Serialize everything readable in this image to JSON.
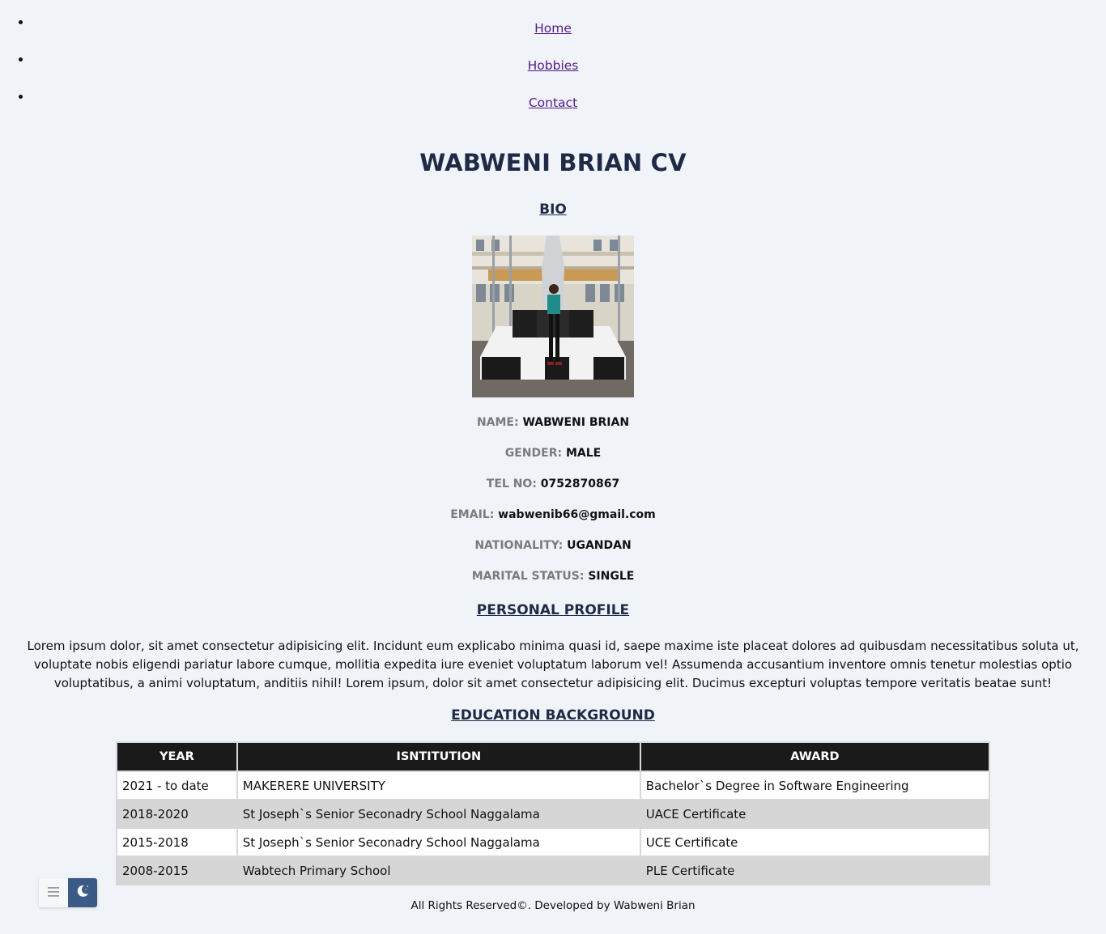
{
  "nav": {
    "items": [
      {
        "label": "Home"
      },
      {
        "label": "Hobbies"
      },
      {
        "label": "Contact"
      }
    ]
  },
  "title": "WABWENI BRIAN CV",
  "bio": {
    "heading": "BIO",
    "fields": [
      {
        "label": "NAME:",
        "value": "WABWENI BRIAN"
      },
      {
        "label": "GENDER:",
        "value": "MALE"
      },
      {
        "label": "TEL NO:",
        "value": "0752870867"
      },
      {
        "label": "EMAIL:",
        "value": "wabwenib66@gmail.com"
      },
      {
        "label": "NATIONALITY:",
        "value": "UGANDAN"
      },
      {
        "label": "MARITAL STATUS:",
        "value": "SINGLE"
      }
    ]
  },
  "profile": {
    "heading": "PERSONAL PROFILE",
    "text": "Lorem ipsum dolor, sit amet consectetur adipisicing elit. Incidunt eum explicabo minima quasi id, saepe maxime iste placeat dolores ad quibusdam necessitatibus soluta ut, voluptate nobis eligendi pariatur labore cumque, mollitia expedita iure eveniet voluptatum laborum vel! Assumenda accusantium inventore omnis tenetur molestias optio voluptatibus, a animi voluptatum, anditiis nihil! Lorem ipsum, dolor sit amet consectetur adipisicing elit. Ducimus excepturi voluptas tempore veritatis beatae sunt!"
  },
  "education": {
    "heading": "EDUCATION BACKGROUND",
    "columns": [
      "YEAR",
      "ISNTITUTION",
      "AWARD"
    ],
    "rows": [
      [
        "2021 - to date",
        "MAKERERE UNIVERSITY",
        "Bachelor`s Degree in Software Engineering"
      ],
      [
        "2018-2020",
        "St Joseph`s Senior Seconadry School Naggalama",
        "UACE Certificate"
      ],
      [
        "2015-2018",
        "St Joseph`s Senior Seconadry School Naggalama",
        "UCE Certificate"
      ],
      [
        "2008-2015",
        "Wabtech Primary School",
        "PLE Certificate"
      ]
    ]
  },
  "footer": "All Rights Reserved©. Developed by Wabweni Brian",
  "widget": {
    "menu_icon": "hamburger-icon",
    "theme_icon": "moon-icon",
    "accent": "#3b5b86"
  }
}
